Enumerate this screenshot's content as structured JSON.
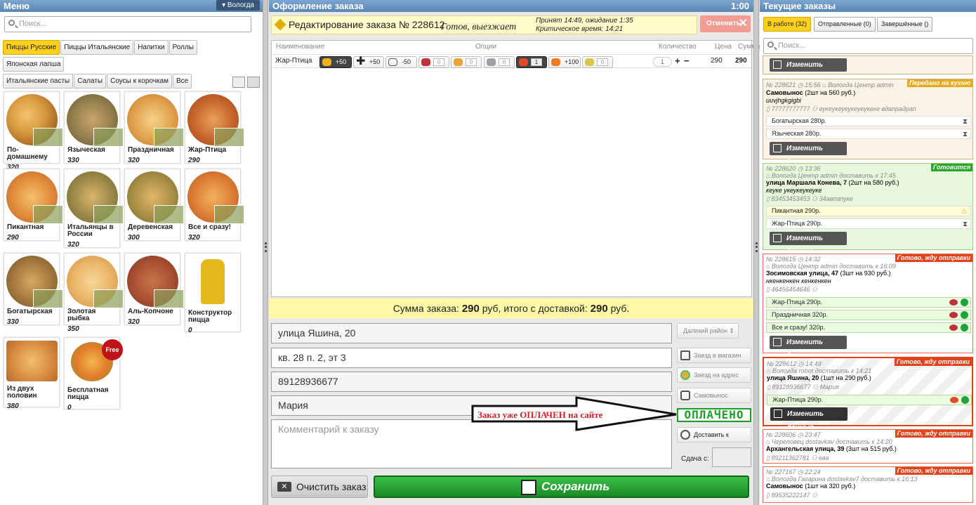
{
  "menu": {
    "title": "Меню",
    "city": "▾ Вологда",
    "search_placeholder": "Поиск...",
    "categories": [
      "Пиццы Русские",
      "Пиццы Итальянские",
      "Напитки",
      "Роллы",
      "Японская лапша",
      "Итальянские пасты",
      "Салаты",
      "Соусы к корочкам",
      "Все"
    ],
    "products": [
      {
        "name": "По-домашнему",
        "price": "320"
      },
      {
        "name": "Языческая",
        "price": "330"
      },
      {
        "name": "Праздничная",
        "price": "320"
      },
      {
        "name": "Жар-Птица",
        "price": "290"
      },
      {
        "name": "Пикантная",
        "price": "290"
      },
      {
        "name": "Итальянцы в России",
        "price": "320"
      },
      {
        "name": "Деревенская",
        "price": "300"
      },
      {
        "name": "Все и сразу!",
        "price": "320"
      },
      {
        "name": "Богатырская",
        "price": "330"
      },
      {
        "name": "Золотая рыбка",
        "price": "350"
      },
      {
        "name": "Аль-Копчоне",
        "price": "320"
      },
      {
        "name": "Конструктор пицца",
        "price": "0"
      },
      {
        "name": "Из двух половин",
        "price": "380"
      },
      {
        "name": "Бесплатная пицца",
        "price": "0"
      }
    ],
    "free_badge": "Free"
  },
  "order": {
    "title": "Оформление заказа",
    "timer": "1:00",
    "edit_label": "Редактирование заказа № 228612",
    "status": "Готов, выезжает",
    "accepted": "Принят 14:49, ожидание 1:35",
    "critical": "Критическое время: 14:21",
    "cancel": "Отменить",
    "columns": {
      "name": "Наименование",
      "options": "Опции",
      "qty": "Количество",
      "price": "Цена",
      "sum": "Сумма"
    },
    "item": {
      "name": "Жар-Птица",
      "qty": "1",
      "price": "290",
      "sum": "290"
    },
    "options": [
      "+50",
      "+50",
      "-50",
      "0",
      "0",
      "0",
      "1",
      "+100",
      "0"
    ],
    "sum_text_a": "Сумма заказа: ",
    "sum_value": "290",
    "sum_text_b": " руб, итого с доставкой: ",
    "sum_total": "290",
    "sum_text_c": " руб.",
    "street": "улица Яшина, 20",
    "flat": "кв. 28 п. 2, эт 3",
    "phone": "89128936677",
    "client": "Мария",
    "comment_placeholder": "Комментарий к заказу",
    "district": "Далекий район",
    "shop": "Заезд в магазин",
    "visit": "Заезд на адрес",
    "pickup": "Самовынос",
    "paid": "ОПЛАЧЕНО",
    "paid_note": "Заказ уже ОПЛАЧЕН  на сайте",
    "deliver": "Доставить к",
    "change": "Сдача с:",
    "clear": "Очистить заказ",
    "save": "Сохранить"
  },
  "current": {
    "title": "Текущие заказы",
    "tab_work": "В работе (32)",
    "tab_sent": "Отправленные (0)",
    "tab_done": "Завершённые ()",
    "search_placeholder": "Поиск...",
    "change_btn": "Изменить данные",
    "orders": [
      {
        "meta": "№ 228621 ◷ 15:56 ⌂ Вологда Центр  admin",
        "badge": "Передано на кухню",
        "addr": "Самовынос",
        "info": "(2шт на 560 руб.)",
        "note": "uuvjhgkgigbi",
        "phone": "▯ 77777777777 ⚇ еукеукеуеукеуеукеке вдапрадрап",
        "items": [
          "Богатырская 280р.",
          "Языческая 280р."
        ]
      },
      {
        "meta": "№ 228620 ◷ 13:36",
        "meta2": "⌂ Вологда Центр  admin доставить к 17:45",
        "badge": "Готовится",
        "addr": "улица Маршала Конева, 7",
        "info": "(2шт на 580 руб.)",
        "note": "кеуке укеукеукеуке",
        "phone": "▯ 83453453453 ⚇ 34авпапуке",
        "items": [
          "Пикантная 290р.",
          "Жар-Птица 290р."
        ]
      },
      {
        "meta": "№ 228615 ◷ 14:32",
        "meta2": "⌂ Вологда Центр  admin доставить к 16:09",
        "badge": "Готово, жду отправки",
        "addr": "Зосимовская улица, 47",
        "info": "(3шт на 930 руб.)",
        "note": "нкенкенкен кенкенкен",
        "phone": "▯ 46456454646 ⚇",
        "items": [
          "Жар-Птица 290р.",
          "Праздничная 320р.",
          "Все и сразу! 320р."
        ]
      },
      {
        "meta": "№ 228612 ◷ 14:49",
        "meta2": "⌂ Вологда  robot доставить к 14:21",
        "badge": "Готово, жду отправки",
        "addr": "улица Яшина, 20",
        "info": "(1шт на 290 руб.)",
        "phone": "▯ 89128936677 ⚇ Мария",
        "items": [
          "Жар-Птица 290р."
        ]
      },
      {
        "meta": "№ 228606 ◷ 23:47",
        "meta2": "⌂ Череповец  dostavkav доставить к 14:20",
        "badge": "Готово, жду отправки",
        "addr": "Архангельская улица, 39",
        "info": "(3шт на 515 руб.)",
        "phone": "▯ 89211362781 ⚇ ева"
      },
      {
        "meta": "№ 227167 ◷ 22:24",
        "meta2": "⌂ Вологда Гагарина  dostavkav7 доставить к 16:13",
        "badge": "Готово, жду отправки",
        "addr": "Самовынос",
        "info": "(1шт на 320 руб.)",
        "phone": "▯ 89535222147 ⚇"
      }
    ]
  }
}
